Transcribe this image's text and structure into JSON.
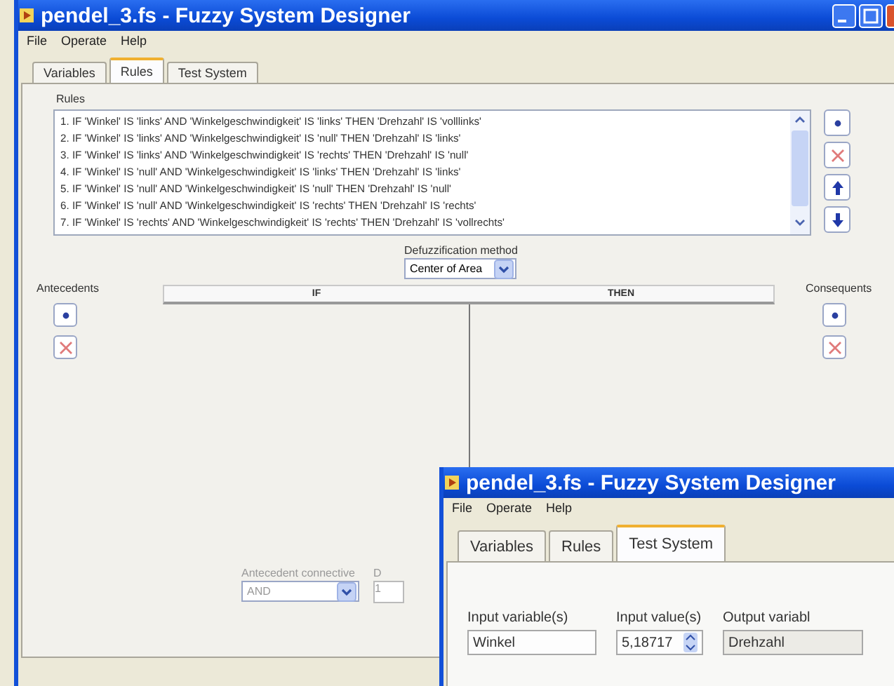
{
  "main_window": {
    "title": "pendel_3.fs - Fuzzy System Designer",
    "menu": [
      "File",
      "Operate",
      "Help"
    ],
    "tabs": [
      {
        "label": "Variables",
        "selected": false
      },
      {
        "label": "Rules",
        "selected": true
      },
      {
        "label": "Test System",
        "selected": false
      }
    ],
    "rules_label": "Rules",
    "rules": [
      "1. IF 'Winkel' IS 'links' AND 'Winkelgeschwindigkeit' IS 'links' THEN 'Drehzahl' IS 'volllinks'",
      "2. IF 'Winkel' IS 'links' AND 'Winkelgeschwindigkeit' IS 'null' THEN 'Drehzahl' IS 'links'",
      "3. IF 'Winkel' IS 'links' AND 'Winkelgeschwindigkeit' IS 'rechts' THEN 'Drehzahl' IS 'null'",
      "4. IF 'Winkel' IS 'null' AND 'Winkelgeschwindigkeit' IS 'links' THEN 'Drehzahl' IS 'links'",
      "5. IF 'Winkel' IS 'null' AND 'Winkelgeschwindigkeit' IS 'null' THEN 'Drehzahl' IS 'null'",
      "6. IF 'Winkel' IS 'null' AND 'Winkelgeschwindigkeit' IS 'rechts' THEN 'Drehzahl' IS 'rechts'",
      "7. IF 'Winkel' IS 'rechts' AND 'Winkelgeschwindigkeit' IS 'rechts' THEN 'Drehzahl' IS 'vollrechts'"
    ],
    "rule_buttons": [
      {
        "kind": "add"
      },
      {
        "kind": "delete"
      },
      {
        "kind": "up"
      },
      {
        "kind": "down"
      }
    ],
    "defuzzification": {
      "label": "Defuzzification method",
      "value": "Center of Area"
    },
    "antecedents_label": "Antecedents",
    "columns": [
      "IF",
      "THEN"
    ],
    "consequents_label": "Consequents",
    "antecedent_buttons": [
      {
        "kind": "add"
      },
      {
        "kind": "delete"
      }
    ],
    "consequent_buttons": [
      {
        "kind": "add"
      },
      {
        "kind": "delete"
      }
    ],
    "antecedent_connective": {
      "label": "Antecedent connective",
      "value": "AND",
      "disabled": true
    },
    "cut_label": "D",
    "cut_value": "1"
  },
  "second_window": {
    "title": "pendel_3.fs - Fuzzy System Designer",
    "menu": [
      "File",
      "Operate",
      "Help"
    ],
    "tabs": [
      {
        "label": "Variables",
        "selected": false
      },
      {
        "label": "Rules",
        "selected": false
      },
      {
        "label": "Test System",
        "selected": true
      }
    ],
    "fields": [
      {
        "label": "Input variable(s)",
        "value": "Winkel",
        "kind": "text"
      },
      {
        "label": "Input value(s)",
        "value": "5,18717",
        "kind": "spin"
      },
      {
        "label": "Output variabl",
        "value": "Drehzahl",
        "kind": "text"
      }
    ]
  }
}
